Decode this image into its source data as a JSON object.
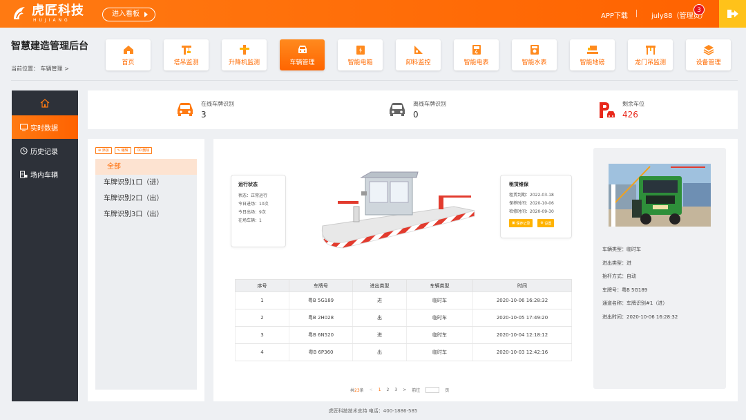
{
  "header": {
    "logo_text": "虎匠科技",
    "logo_sub": "HUJIANG",
    "kanban_label": "进入看板",
    "app_download": "APP下载",
    "user": "july88（管理员）",
    "badge_count": "3",
    "logout_icon": "logout-icon",
    "accent": "#ff6a00"
  },
  "system_title": "智慧建造管理后台",
  "breadcrumb": "当前位置：  车辆管理 >",
  "nav": [
    {
      "label": "首页",
      "icon": "home-icon"
    },
    {
      "label": "塔吊监测",
      "icon": "tower-crane-icon"
    },
    {
      "label": "升降机监测",
      "icon": "elevator-icon"
    },
    {
      "label": "车辆管理",
      "icon": "car-icon",
      "active": true
    },
    {
      "label": "智能电箱",
      "icon": "electric-box-icon"
    },
    {
      "label": "卸料监控",
      "icon": "unloading-icon"
    },
    {
      "label": "智能电表",
      "icon": "electric-meter-icon"
    },
    {
      "label": "智能水表",
      "icon": "water-meter-icon"
    },
    {
      "label": "智能地磅",
      "icon": "weighbridge-icon"
    },
    {
      "label": "龙门吊监测",
      "icon": "gantry-crane-icon"
    },
    {
      "label": "设备管理",
      "icon": "device-icon"
    }
  ],
  "sidebar": {
    "home_icon": "home-outline-icon",
    "items": [
      {
        "label": "实时数据",
        "icon": "monitor-icon",
        "active": true
      },
      {
        "label": "历史记录",
        "icon": "clock-icon"
      },
      {
        "label": "场内车辆",
        "icon": "car-list-icon"
      }
    ]
  },
  "stats": [
    {
      "label": "在线车牌识别",
      "value": "3",
      "icon": "car-online-icon"
    },
    {
      "label": "离线车牌识别",
      "value": "0",
      "icon": "car-offline-icon"
    },
    {
      "label": "剩余车位",
      "value": "426",
      "icon": "parking-icon"
    }
  ],
  "toolbar": {
    "add": "添加",
    "edit": "编辑",
    "delete": "删除"
  },
  "gate_list": [
    {
      "label": "全部",
      "active": true
    },
    {
      "label": "车牌识别1口（进）"
    },
    {
      "label": "车牌识别2口（出）"
    },
    {
      "label": "车牌识别3口（出）"
    }
  ],
  "run_status": {
    "title": "运行状态",
    "lines": [
      "状态：正常运行",
      "今日进场：10次",
      "今日出场：9次",
      "在场车辆：1"
    ]
  },
  "maintenance": {
    "title": "租赁维保",
    "lines": [
      "租赁到期：2022-03-18",
      "保养时间：2020-10-06",
      "检修时间：2020-09-30"
    ],
    "record_btn": "保养记录",
    "settings_btn": "设置"
  },
  "table": {
    "headers": [
      "序号",
      "车牌号",
      "进出类型",
      "车辆类型",
      "时间"
    ],
    "rows": [
      [
        "1",
        "粤B 5G189",
        "进",
        "临时车",
        "2020-10-06 16:28:32"
      ],
      [
        "2",
        "粤B 2H028",
        "出",
        "临时车",
        "2020-10-05 17:49:20"
      ],
      [
        "3",
        "粤B 6N520",
        "进",
        "临时车",
        "2020-10-04 12:18:12"
      ],
      [
        "4",
        "粤B 6P360",
        "出",
        "临时车",
        "2020-10-03 12:42:16"
      ]
    ]
  },
  "pager": {
    "total_prefix": "共",
    "total": "23",
    "total_suffix": "条",
    "prev": "<",
    "pages": [
      "1",
      "2",
      "3"
    ],
    "current": "1",
    "next": ">",
    "goto": "前往",
    "page_unit": "页"
  },
  "detail": {
    "lines": [
      "车辆类型：临时车",
      "进出类型：进",
      "抬杆方式：自动",
      "车牌号：粤B 5G189",
      "通道名称：车牌识别#1（进）",
      "进出时间：2020-10-06 16:28:32"
    ]
  },
  "footer": "虎匠科技技术支持    电话：400-1886-585"
}
